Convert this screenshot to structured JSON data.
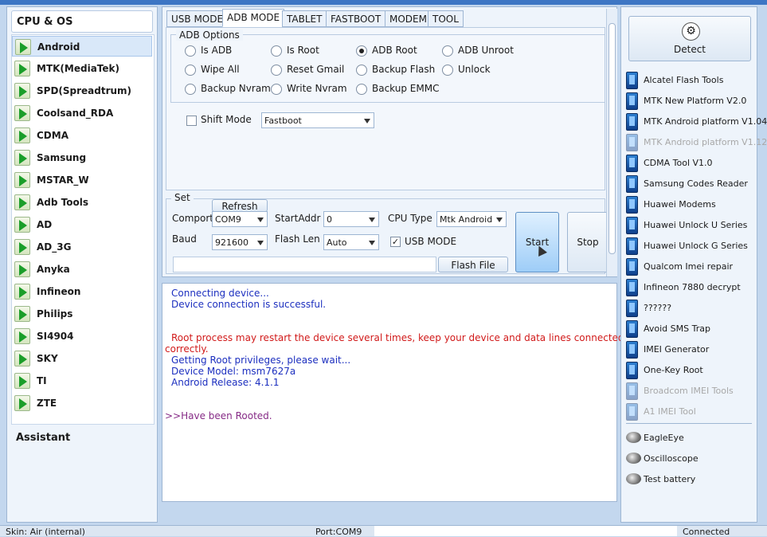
{
  "left": {
    "header": "CPU & OS",
    "items": [
      "Android",
      "MTK(MediaTek)",
      "SPD(Spreadtrum)",
      "Coolsand_RDA",
      "CDMA",
      "Samsung",
      "MSTAR_W",
      "Adb Tools",
      "AD",
      "AD_3G",
      "Anyka",
      "Infineon",
      "Philips",
      "SI4904",
      "SKY",
      "TI",
      "ZTE"
    ],
    "selected": "Android",
    "assistant": "Assistant"
  },
  "tabs": [
    "USB MODE",
    "ADB MODE",
    "TABLET",
    "FASTBOOT",
    "MODEM",
    "TOOL"
  ],
  "active_tab": "ADB MODE",
  "adb_options": {
    "title": "ADB Options",
    "radios": [
      "Is ADB",
      "Is Root",
      "ADB Root",
      "ADB Unroot",
      "Wipe All",
      "Reset Gmail",
      "Backup Flash",
      "Unlock",
      "Backup Nvram",
      "Write Nvram",
      "Backup EMMC"
    ],
    "selected": "ADB Root",
    "shift_mode_label": "Shift Mode",
    "shift_mode_value": "Fastboot"
  },
  "set": {
    "title": "Set",
    "refresh": "Refresh",
    "comport_label": "Comport",
    "comport_value": "COM9",
    "startaddr_label": "StartAddr",
    "startaddr_value": "0",
    "cputype_label": "CPU Type",
    "cputype_value": "Mtk Android",
    "baud_label": "Baud",
    "baud_value": "921600",
    "flashlen_label": "Flash Len",
    "flashlen_value": "Auto",
    "usbmode_label": "USB MODE",
    "usbmode_checked": true,
    "flash_file": "Flash File",
    "start": "Start",
    "stop": "Stop"
  },
  "log": {
    "l1": "Connecting device...",
    "l2": "Device connection is successful.",
    "l3": "Root process may restart the device several times, keep your device and data lines connected",
    "l4": "correctly.",
    "l5": "Getting Root privileges, please wait...",
    "l6": "Device Model: msm7627a",
    "l7": "Android Release: 4.1.1",
    "l8": ">>Have been Rooted."
  },
  "right": {
    "detect": "Detect",
    "tools": [
      {
        "name": "Alcatel Flash Tools",
        "disabled": false
      },
      {
        "name": "MTK New Platform V2.0",
        "disabled": false
      },
      {
        "name": "MTK Android platform V1.04",
        "disabled": false
      },
      {
        "name": "MTK Android platform V1.12",
        "disabled": true
      },
      {
        "name": "CDMA Tool  V1.0",
        "disabled": false
      },
      {
        "name": "Samsung Codes Reader",
        "disabled": false
      },
      {
        "name": "Huawei Modems",
        "disabled": false
      },
      {
        "name": "Huawei Unlock U Series",
        "disabled": false
      },
      {
        "name": "Huawei Unlock G Series",
        "disabled": false
      },
      {
        "name": "Qualcom Imei repair",
        "disabled": false
      },
      {
        "name": "Infineon 7880 decrypt",
        "disabled": false
      },
      {
        "name": "??????",
        "disabled": false
      },
      {
        "name": "Avoid SMS Trap",
        "disabled": false
      },
      {
        "name": "IMEI Generator",
        "disabled": false
      },
      {
        "name": "One-Key Root",
        "disabled": false
      },
      {
        "name": "Broadcom IMEI Tools",
        "disabled": true
      },
      {
        "name": "A1 IMEI Tool",
        "disabled": true
      }
    ],
    "extras": [
      "EagleEye",
      "Oscilloscope",
      "Test battery"
    ]
  },
  "status": {
    "skin": "Skin: Air (internal)",
    "port": "Port:COM9",
    "state": "Connected"
  }
}
